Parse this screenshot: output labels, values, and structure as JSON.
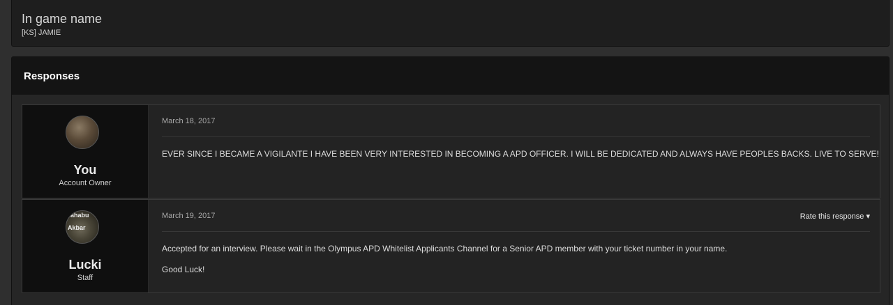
{
  "field": {
    "title": "In game name",
    "value": "[KS] JAMIE"
  },
  "responses": {
    "heading": "Responses",
    "posts": [
      {
        "author": "You",
        "role": "Account Owner",
        "date": "March 18, 2017",
        "lines": [
          "EVER SINCE I BECAME A VIGILANTE I HAVE BEEN VERY INTERESTED IN BECOMING A APD OFFICER. I WILL BE DEDICATED AND ALWAYS HAVE PEOPLES BACKS. LIVE TO SERVE!"
        ]
      },
      {
        "author": "Lucki",
        "role": "Staff",
        "date": "March 19, 2017",
        "rate_label": "Rate this response ▾",
        "avatar_text": [
          "ahabu",
          "Akbar"
        ],
        "lines": [
          "Accepted for an interview. Please wait in the Olympus APD Whitelist Applicants Channel for a Senior APD member with your ticket number in your name.",
          "Good Luck!"
        ]
      }
    ]
  }
}
